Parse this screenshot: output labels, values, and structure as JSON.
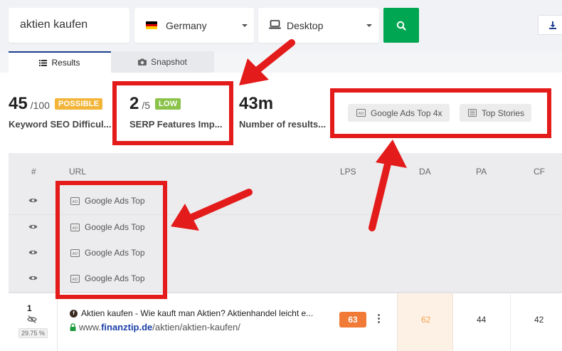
{
  "search": {
    "query": "aktien kaufen"
  },
  "country": {
    "label": "Germany"
  },
  "device": {
    "label": "Desktop"
  },
  "tabs": {
    "results": "Results",
    "snapshot": "Snapshot"
  },
  "metrics": {
    "keyword_seo": {
      "value": "45",
      "max": "/100",
      "badge": "POSSIBLE",
      "badge_color": "#f2b53a",
      "label": "Keyword SEO Difficul..."
    },
    "serp_features": {
      "value": "2",
      "max": "/5",
      "badge": "LOW",
      "badge_color": "#8bc34a",
      "label": "SERP Features Imp..."
    },
    "results": {
      "value": "43m",
      "label": "Number of results..."
    }
  },
  "serp_chips": [
    "Google Ads Top 4x",
    "Top Stories"
  ],
  "table": {
    "headers": {
      "num": "#",
      "url": "URL",
      "lps": "LPS",
      "da": "DA",
      "pa": "PA",
      "cf": "CF"
    },
    "ad_rows": [
      "Google Ads Top",
      "Google Ads Top",
      "Google Ads Top",
      "Google Ads Top"
    ],
    "result": {
      "rank": "1",
      "pct": "29.75 %",
      "title": "Aktien kaufen - Wie kauft man Aktien? Aktienhandel leicht e...",
      "url_prefix": "www.",
      "url_domain": "finanztip.de",
      "url_path": "/aktien/aktien-kaufen/",
      "lps": "63",
      "da": "62",
      "pa": "44",
      "cf": "42"
    }
  },
  "icons": [
    "german-flag-icon",
    "laptop-icon",
    "search-icon",
    "download-icon",
    "list-icon",
    "camera-icon",
    "ad-icon",
    "news-icon",
    "eye-icon",
    "eye-slash-icon",
    "lock-icon",
    "kebab-menu-icon"
  ],
  "colors": {
    "accent_green": "#00a651",
    "annotation_red": "#e31b1b",
    "tab_active": "#1d3f8f",
    "lps_orange": "#f07a36",
    "link_blue": "#1b3fa8"
  }
}
